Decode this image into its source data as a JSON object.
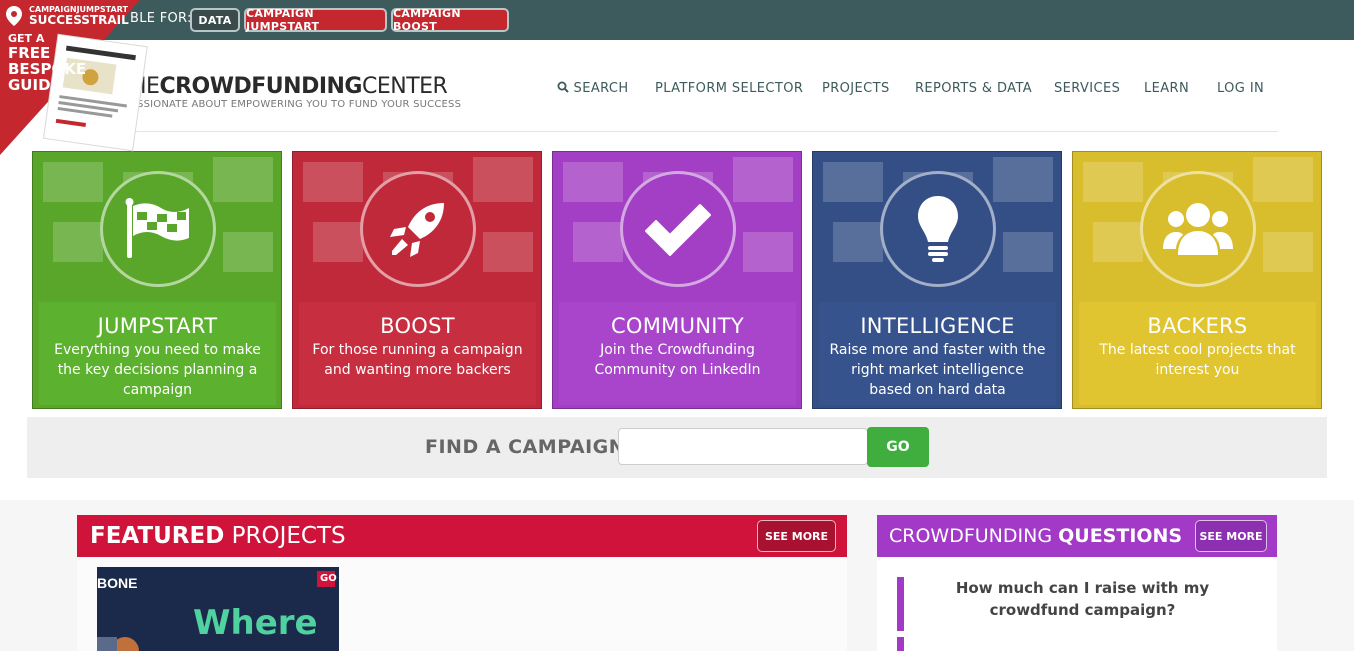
{
  "topbar": {
    "available_text": "BLE FOR:",
    "pills": [
      "DATA",
      "CAMPAIGN JUMPSTART",
      "CAMPAIGN BOOST"
    ]
  },
  "corner_banner": {
    "brand_small": "CAMPAIGNJUMPSTART",
    "brand_large": "SUCCESSTRAIL",
    "offer_lines": [
      "GET A",
      "FREE",
      "BESPOKE",
      "GUIDE"
    ],
    "color": "#c4282e"
  },
  "header": {
    "logo_prefix": "HE",
    "logo_bold": "CROWDFUNDING",
    "logo_suffix": "CENTER",
    "tagline": "ASSIONATE ABOUT EMPOWERING YOU TO FUND YOUR SUCCESS"
  },
  "nav": {
    "search": "SEARCH",
    "items": [
      "PLATFORM SELECTOR",
      "PROJECTS",
      "REPORTS & DATA",
      "SERVICES",
      "LEARN",
      "LOG IN"
    ]
  },
  "tiles": [
    {
      "title": "JUMPSTART",
      "desc": "Everything you need to make the key decisions planning a campaign",
      "icon": "flag-icon",
      "color": "#5aa62a",
      "panel": "#5cb22e"
    },
    {
      "title": "BOOST",
      "desc": "For those running a campaign and wanting more backers",
      "icon": "rocket-icon",
      "color": "#c0293a",
      "panel": "#c72f41"
    },
    {
      "title": "COMMUNITY",
      "desc": "Join the Crowdfunding Community on LinkedIn",
      "icon": "checkmark-icon",
      "color": "#a23fc4",
      "panel": "#a945cb"
    },
    {
      "title": "INTELLIGENCE",
      "desc": "Raise more and faster with the right market intelligence based on hard data",
      "icon": "lightbulb-icon",
      "color": "#334f86",
      "panel": "#36538d"
    },
    {
      "title": "BACKERS",
      "desc": "The latest cool projects that interest you",
      "icon": "users-icon",
      "color": "#d8bd2c",
      "panel": "#e0c430"
    }
  ],
  "find": {
    "label": "FIND A CAMPAIGN:",
    "placeholder": "",
    "button": "GO"
  },
  "featured": {
    "title_bold": "FEATURED",
    "title_rest": " PROJECTS",
    "see_more": "SEE MORE",
    "project": {
      "badge_left": "BONE",
      "badge_right": "GO",
      "headline": "Where"
    }
  },
  "questions": {
    "title_regular": "CROWDFUNDING ",
    "title_bold": "QUESTIONS",
    "see_more": "SEE MORE",
    "items": [
      "How much can I raise with my crowdfund campaign?"
    ]
  }
}
